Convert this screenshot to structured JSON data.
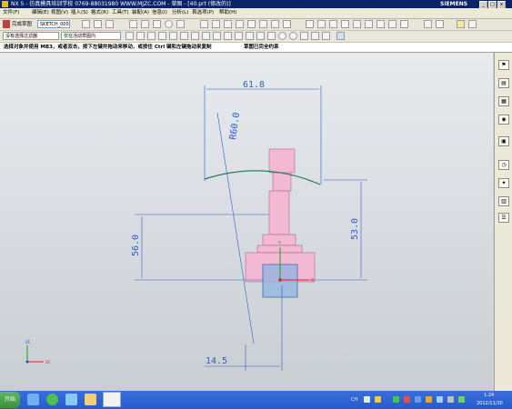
{
  "window": {
    "title": "NX 5 - 仿真模具培训学校  0769-88031980  WWW.MJZC.COM - 草图 - [40.prt (修改的)]",
    "brand": "SIEMENS"
  },
  "menu": {
    "items": [
      "文件(F)",
      "编辑(E)",
      "视图(V)",
      "插入(S)",
      "格式(R)",
      "工具(T)",
      "装配(A)",
      "信息(I)",
      "分析(L)",
      "首选项(P)",
      "帮助(H)"
    ]
  },
  "toolbar1": {
    "finish_label": "完成草图",
    "sketch_name": "SKETCH_000"
  },
  "toolbar2": {
    "filter": "没有选择过滤器",
    "scope": "仅在活动草图内"
  },
  "cue": {
    "prompt": "选择对象并使用 MB3，或者双击，按下左键并拖动来移动，或按住 Ctrl 键和左键拖动来复制",
    "status": "草图已完全约束"
  },
  "dimensions": {
    "width": "61.8",
    "radius": "R60.0",
    "left_height": "56.0",
    "right_height": "53.0",
    "bottom": "14.5"
  },
  "triad": {
    "x": "X",
    "y": "Y",
    "zc": "ZC",
    "xc": "XC"
  },
  "taskbar": {
    "start": "开始",
    "lang": "CH",
    "time": "1:24",
    "date": "2012/11/30"
  },
  "colors": {
    "dimension": "#2b5ec9",
    "part": "#f3b9d3",
    "arc": "#1a7a52"
  }
}
